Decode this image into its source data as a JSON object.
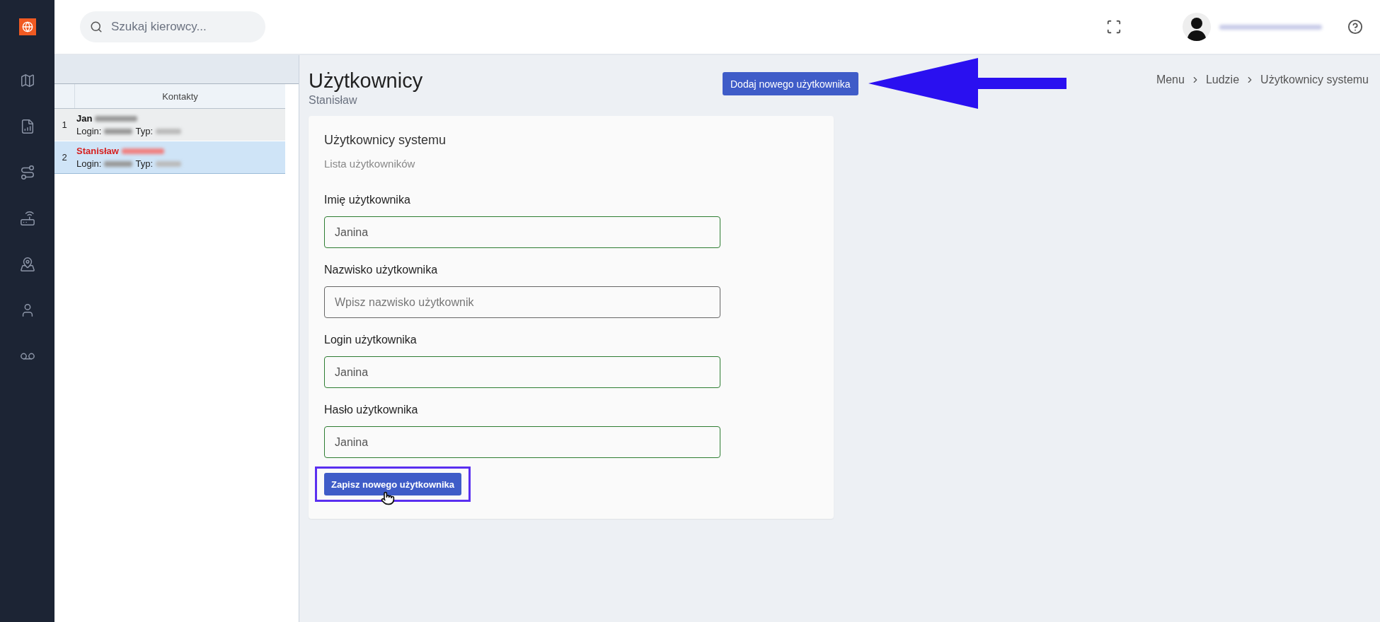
{
  "header": {
    "search": {
      "placeholder": "Szukaj kierowcy..."
    }
  },
  "contacts": {
    "heading": "Kontakty",
    "rows": [
      {
        "number": "1",
        "name": "Jan",
        "login_label": "Login:",
        "type_label": "Typ:",
        "selected": false
      },
      {
        "number": "2",
        "name": "Stanisław",
        "login_label": "Login:",
        "type_label": "Typ:",
        "selected": true
      }
    ]
  },
  "page": {
    "title": "Użytkownicy",
    "subtitle": "Stanisław",
    "add_button": "Dodaj nowego użytkownika",
    "breadcrumbs": [
      "Menu",
      "Ludzie",
      "Użytkownicy systemu"
    ]
  },
  "card": {
    "title": "Użytkownicy systemu",
    "subtitle": "Lista użytkowników",
    "fields": [
      {
        "label": "Imię użytkownika",
        "value": "Janina",
        "valid": true
      },
      {
        "label": "Nazwisko użytkownika",
        "placeholder": "Wpisz nazwisko użytkownik",
        "valid": false
      },
      {
        "label": "Login użytkownika",
        "value": "Janina",
        "valid": true
      },
      {
        "label": "Hasło użytkownika",
        "value": "Janina",
        "valid": true
      }
    ],
    "save_button": "Zapisz nowego użytkownika",
    "save_highlighted": true
  }
}
